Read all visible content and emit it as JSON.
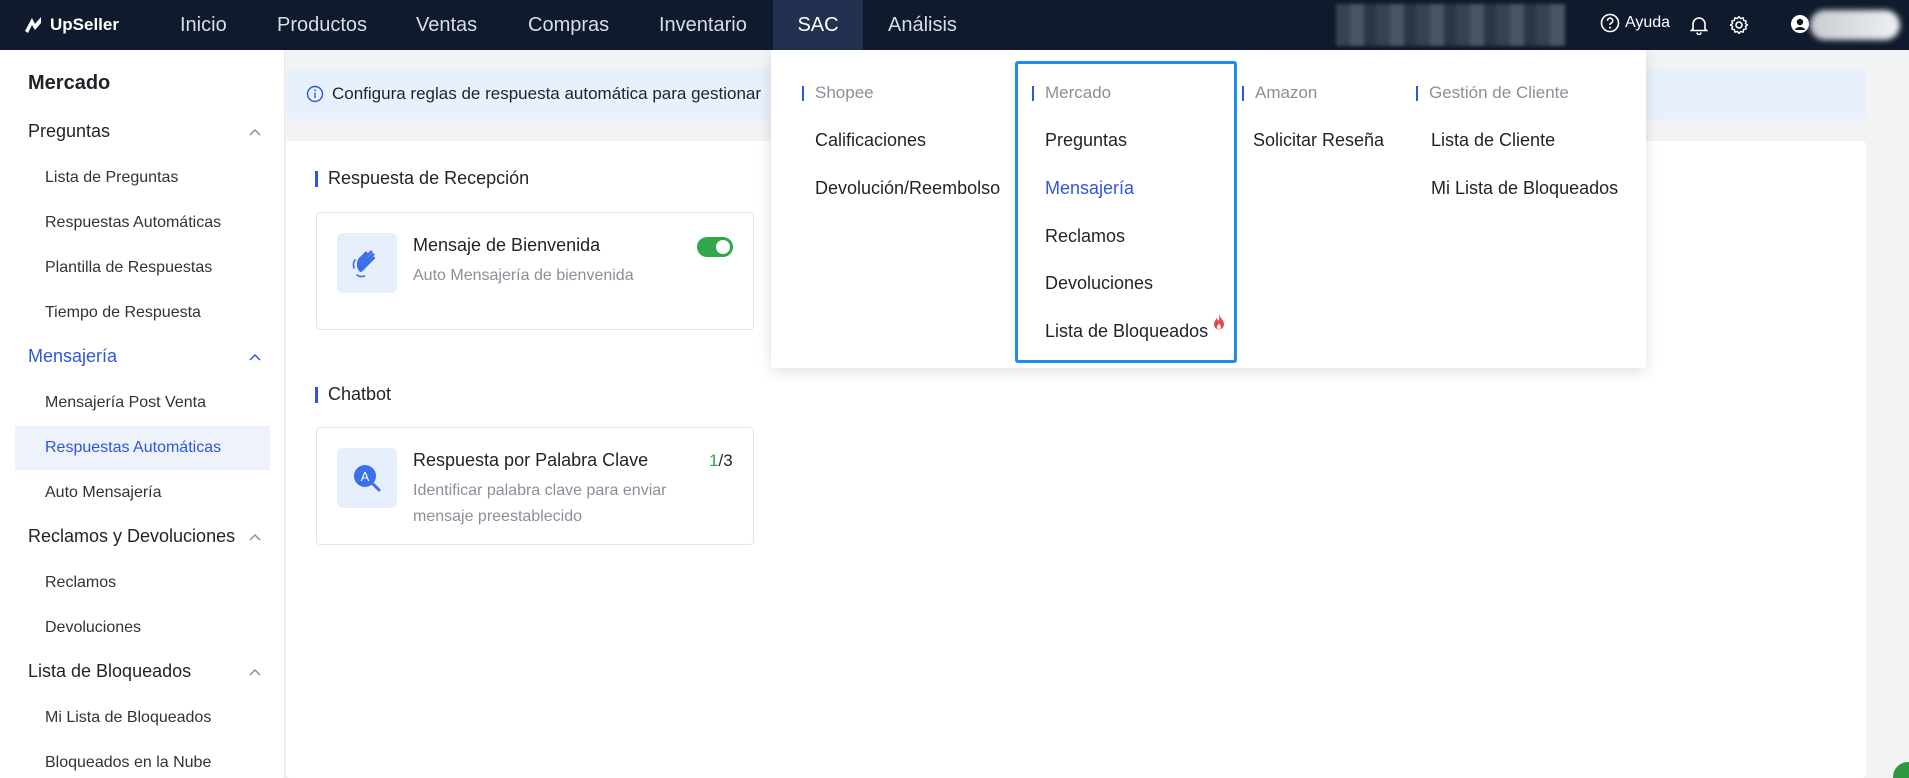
{
  "brand": {
    "name": "UpSeller"
  },
  "nav": {
    "items": [
      {
        "label": "Inicio"
      },
      {
        "label": "Productos"
      },
      {
        "label": "Ventas"
      },
      {
        "label": "Compras"
      },
      {
        "label": "Inventario"
      },
      {
        "label": "SAC"
      },
      {
        "label": "Análisis"
      }
    ],
    "active": "SAC",
    "help_label": "Ayuda"
  },
  "sidebar": {
    "title": "Mercado",
    "groups": [
      {
        "label": "Preguntas",
        "items": [
          "Lista de Preguntas",
          "Respuestas Automáticas",
          "Plantilla de Respuestas",
          "Tiempo de Respuesta"
        ]
      },
      {
        "label": "Mensajería",
        "items": [
          "Mensajería Post Venta",
          "Respuestas Automáticas",
          "Auto Mensajería"
        ]
      },
      {
        "label": "Reclamos y Devoluciones",
        "items": [
          "Reclamos",
          "Devoluciones"
        ]
      },
      {
        "label": "Lista de Bloqueados",
        "items": [
          "Mi Lista de Bloqueados",
          "Bloqueados en la Nube"
        ]
      }
    ],
    "active_group": "Mensajería",
    "active_item": "Respuestas Automáticas"
  },
  "main": {
    "info_text": "Configura reglas de respuesta automática para gestionar",
    "sections": [
      {
        "title": "Respuesta de Recepción",
        "card": {
          "title": "Mensaje de Bienvenida",
          "desc": "Auto Mensajería de bienvenida",
          "enabled": true
        }
      },
      {
        "title": "Chatbot",
        "card": {
          "title": "Respuesta por Palabra Clave",
          "desc": "Identificar palabra clave para enviar mensaje preestablecido",
          "count_used": "1",
          "count_total": "/3",
          "icon_letter": "A"
        }
      }
    ]
  },
  "dropdown": {
    "columns": [
      {
        "title": "Shopee",
        "items": [
          "Calificaciones",
          "Devolución/Reembolso"
        ]
      },
      {
        "title": "Mercado",
        "items": [
          "Preguntas",
          "Mensajería",
          "Reclamos",
          "Devoluciones",
          "Lista de Bloqueados"
        ]
      },
      {
        "title": "Amazon",
        "items": [
          "Solicitar Reseña"
        ]
      },
      {
        "title": "Gestión de Cliente",
        "items": [
          "Lista de Cliente",
          "Mi Lista de Bloqueados"
        ]
      }
    ],
    "active_item": "Mensajería",
    "hot_item": "Lista de Bloqueados"
  },
  "colors": {
    "topbar": "#0f1a2c",
    "accent": "#2f57d9",
    "highlight_border": "#1e8cf0",
    "toggle_on": "#31a64a",
    "hot_icon": "#e5484d"
  }
}
